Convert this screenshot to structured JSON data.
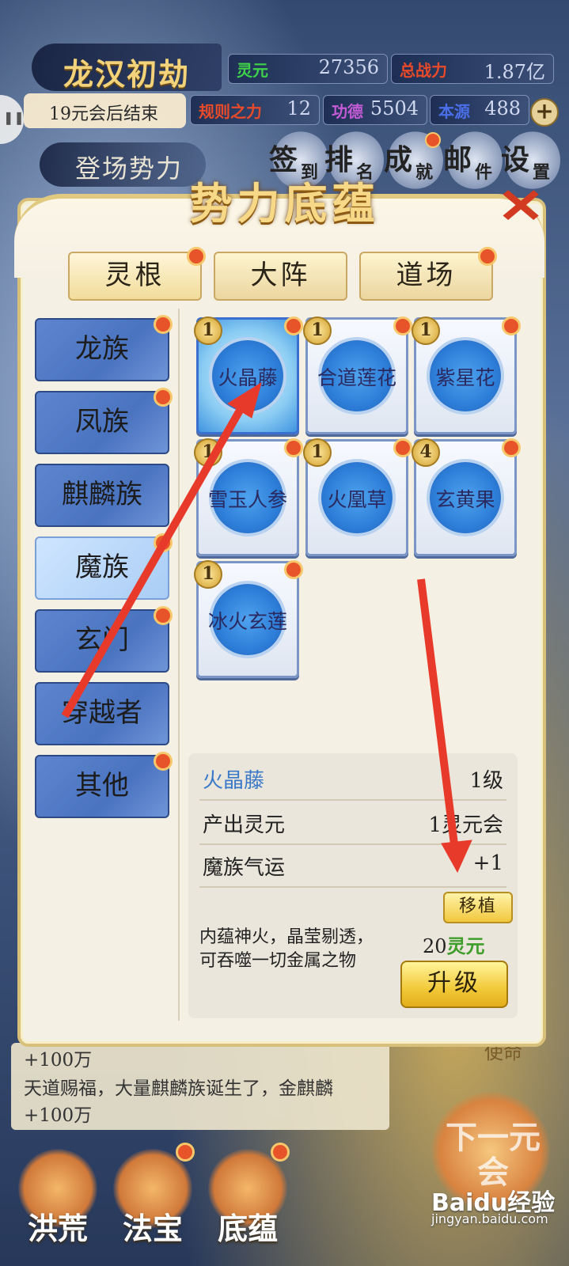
{
  "hud": {
    "title": "龙汉初劫",
    "countdown": "19元会后结束",
    "stats": [
      {
        "label": "灵元",
        "value": "27356",
        "color": "#3fd24a"
      },
      {
        "label": "总战力",
        "value": "1.87亿",
        "color": "#e84a2a"
      },
      {
        "label": "规则之力",
        "value": "12",
        "color": "#e84a2a"
      },
      {
        "label": "功德",
        "value": "5504",
        "color": "#c45bd6"
      },
      {
        "label": "本源",
        "value": "488",
        "color": "#4a6fe8"
      }
    ],
    "debut_label": "登场势力",
    "top_buttons": [
      {
        "big": "签",
        "small": "到"
      },
      {
        "big": "排",
        "small": "名"
      },
      {
        "big": "成",
        "small": "就"
      },
      {
        "big": "邮",
        "small": "件"
      },
      {
        "big": "设",
        "small": "置"
      }
    ]
  },
  "panel": {
    "title": "势力底蕴",
    "tabs": [
      "灵根",
      "大阵",
      "道场"
    ],
    "side_items": [
      "龙族",
      "凤族",
      "麒麟族",
      "魔族",
      "玄门",
      "穿越者",
      "其他"
    ],
    "cards": [
      {
        "name": "火晶藤",
        "level": "1"
      },
      {
        "name": "合道莲花",
        "level": "1"
      },
      {
        "name": "紫星花",
        "level": "1"
      },
      {
        "name": "雪玉人参",
        "level": "1"
      },
      {
        "name": "火凰草",
        "level": "1"
      },
      {
        "name": "玄黄果",
        "level": "4"
      },
      {
        "name": "冰火玄莲",
        "level": "1"
      }
    ],
    "detail": {
      "name": "火晶藤",
      "level": "1级",
      "output_label": "产出灵元",
      "output_value": "1灵元会",
      "luck_label": "魔族气运",
      "luck_value": "+1",
      "move_label": "移植",
      "desc_line1": "内蕴神火，晶莹剔透，",
      "desc_line2": "可吞噬一切金属之物",
      "cost_num": "20",
      "cost_unit": "灵元",
      "upgrade_label": "升级"
    }
  },
  "log": {
    "line0": "+100万",
    "line1": "天道赐福，大量麒麟族诞生了，金麒麟",
    "line2": "+100万"
  },
  "bottom_nav": [
    "洪荒",
    "法宝",
    "底蕴"
  ],
  "next_label": "下一元会",
  "side_right_label": "使命",
  "watermark": {
    "brand": "Baidu经验",
    "url": "jingyan.baidu.com"
  },
  "colors": {
    "accent_red": "#e83a2a",
    "gold": "#f2d27a"
  }
}
